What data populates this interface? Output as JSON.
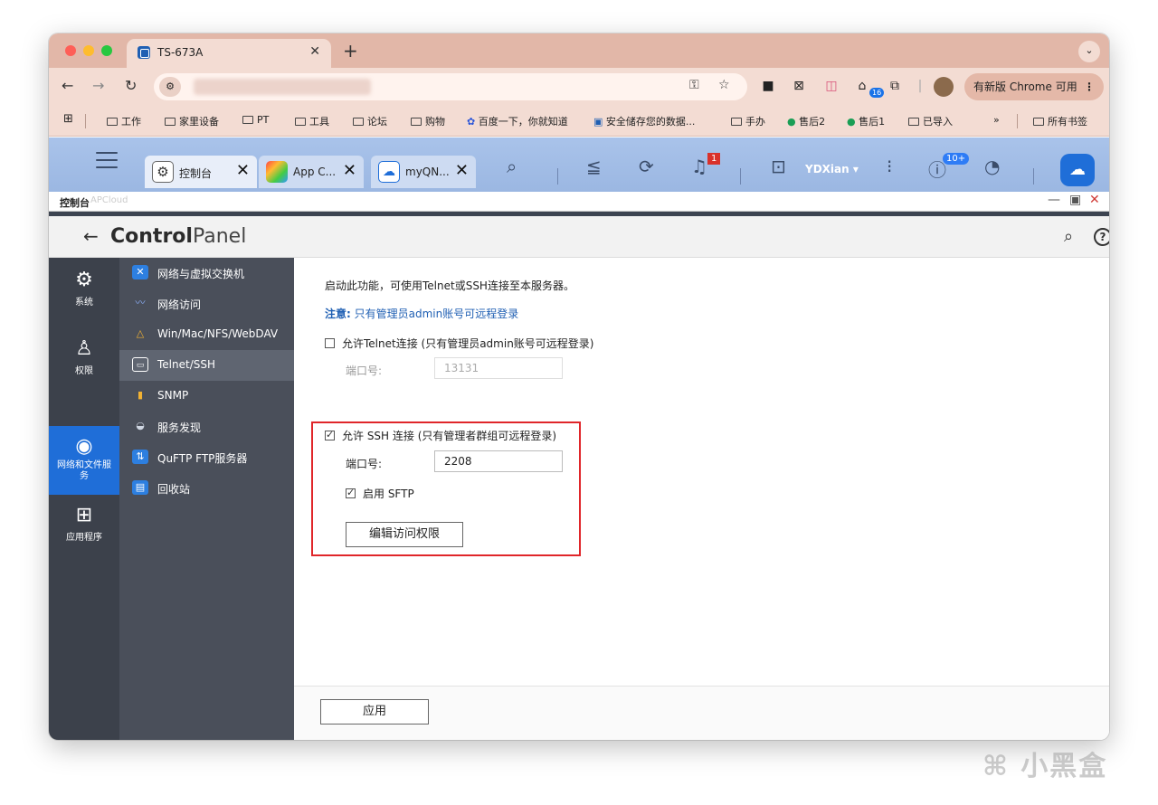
{
  "browser": {
    "tab_title": "TS-673A",
    "update_button": "有新版 Chrome 可用",
    "ext_badge": "16",
    "bookmarks": [
      {
        "label": "工作"
      },
      {
        "label": "家里设备"
      },
      {
        "label": "PT"
      },
      {
        "label": "工具"
      },
      {
        "label": "论坛"
      },
      {
        "label": "购物"
      },
      {
        "label": "百度一下，你就知道"
      },
      {
        "label": "安全储存您的数据..."
      },
      {
        "label": "手办"
      },
      {
        "label": "售后2"
      },
      {
        "label": "售后1"
      },
      {
        "label": "已导入"
      }
    ],
    "bookmarks_more": "»",
    "all_bookmarks": "所有书签"
  },
  "qts": {
    "tabs": [
      {
        "label": "控制台"
      },
      {
        "label": "App C..."
      },
      {
        "label": "myQN..."
      }
    ],
    "notification_count": "1",
    "user": "YDXian ▾",
    "badge_10plus": "10+"
  },
  "window": {
    "title": "控制台",
    "ghost_text": "APCloud"
  },
  "control_panel": {
    "logo_bold": "Control",
    "logo_light": "Panel",
    "rail": [
      {
        "label": "系统",
        "icon": "gear-icon"
      },
      {
        "label": "权限",
        "icon": "user-icon"
      },
      {
        "label": "网络和文件服务",
        "icon": "globe-icon"
      },
      {
        "label": "应用程序",
        "icon": "apps-icon"
      }
    ],
    "submenu": [
      {
        "label": "网络与虚拟交换机"
      },
      {
        "label": "网络访问"
      },
      {
        "label": "Win/Mac/NFS/WebDAV"
      },
      {
        "label": "Telnet/SSH"
      },
      {
        "label": "SNMP"
      },
      {
        "label": "服务发现"
      },
      {
        "label": "QuFTP FTP服务器"
      },
      {
        "label": "回收站"
      }
    ]
  },
  "content": {
    "intro": "启动此功能，可使用Telnet或SSH连接至本服务器。",
    "note_label": "注意:",
    "note_text": "只有管理员admin账号可远程登录",
    "telnet_label": "允许Telnet连接 (只有管理员admin账号可远程登录)",
    "telnet_checked": false,
    "telnet_port_label": "端口号:",
    "telnet_port_value": "13131",
    "ssh_label": "允许 SSH 连接 (只有管理者群组可远程登录)",
    "ssh_checked": true,
    "ssh_port_label": "端口号:",
    "ssh_port_value": "2208",
    "sftp_label": "启用 SFTP",
    "sftp_checked": true,
    "edit_access_button": "编辑访问权限",
    "apply_button": "应用"
  },
  "watermark": "小黑盒"
}
